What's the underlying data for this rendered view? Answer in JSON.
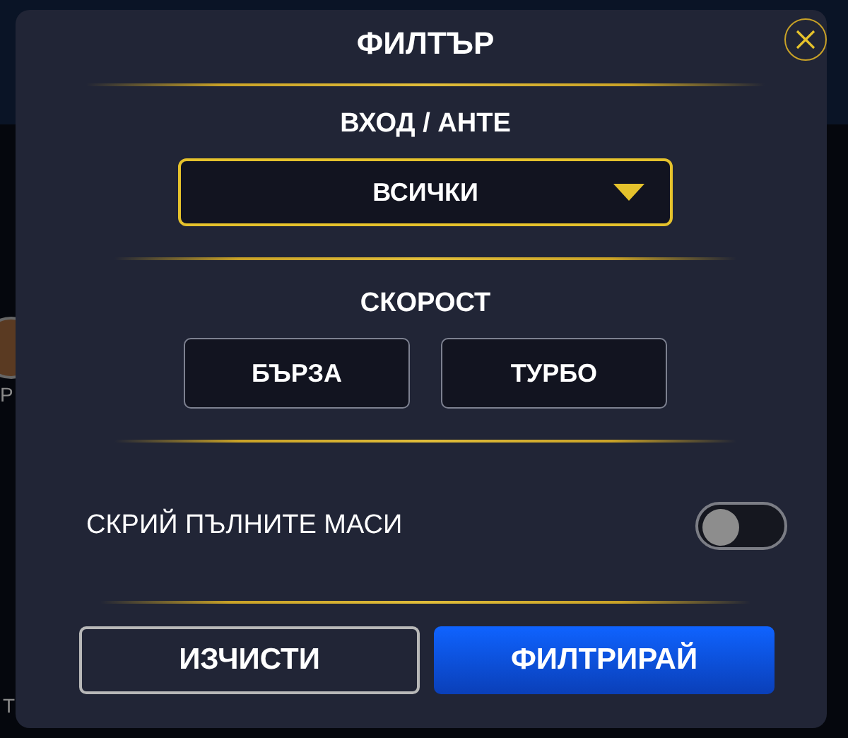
{
  "background": {
    "fragments": [
      "Р",
      "Т"
    ]
  },
  "dialog": {
    "title": "ФИЛТЪР",
    "entry": {
      "label": "ВХОД / АНТЕ",
      "dropdown": {
        "value": "ВСИЧКИ"
      }
    },
    "speed": {
      "label": "СКОРОСТ",
      "options": [
        {
          "label": "БЪРЗА",
          "selected": false
        },
        {
          "label": "ТУРБО",
          "selected": false
        }
      ]
    },
    "hide_full_tables": {
      "label": "СКРИЙ ПЪЛНИТЕ МАСИ",
      "on": false
    },
    "buttons": [
      {
        "label": "ИЗЧИСТИ",
        "kind": "outline"
      },
      {
        "label": "ФИЛТРИРАЙ",
        "kind": "primary"
      }
    ]
  }
}
